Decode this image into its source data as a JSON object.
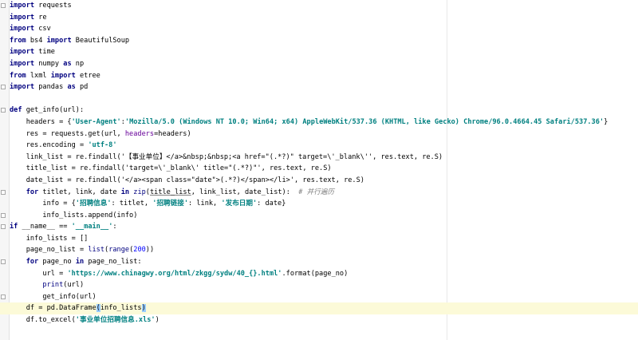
{
  "editor": {
    "lines": [
      {
        "fold": true,
        "tokens": [
          [
            "kw",
            "import"
          ],
          [
            "txt",
            " requests"
          ]
        ]
      },
      {
        "tokens": [
          [
            "kw",
            "import"
          ],
          [
            "txt",
            " re"
          ]
        ]
      },
      {
        "tokens": [
          [
            "kw",
            "import"
          ],
          [
            "txt",
            " csv"
          ]
        ]
      },
      {
        "tokens": [
          [
            "kw",
            "from"
          ],
          [
            "txt",
            " bs4 "
          ],
          [
            "kw",
            "import"
          ],
          [
            "txt",
            " BeautifulSoup"
          ]
        ]
      },
      {
        "tokens": [
          [
            "kw",
            "import"
          ],
          [
            "txt",
            " time"
          ]
        ]
      },
      {
        "tokens": [
          [
            "kw",
            "import"
          ],
          [
            "txt",
            " numpy "
          ],
          [
            "kw",
            "as"
          ],
          [
            "txt",
            " np"
          ]
        ]
      },
      {
        "tokens": [
          [
            "kw",
            "from"
          ],
          [
            "txt",
            " lxml "
          ],
          [
            "kw",
            "import"
          ],
          [
            "txt",
            " etree"
          ]
        ]
      },
      {
        "fold": true,
        "tokens": [
          [
            "kw",
            "import"
          ],
          [
            "txt",
            " pandas "
          ],
          [
            "kw",
            "as"
          ],
          [
            "txt",
            " pd"
          ]
        ]
      },
      {
        "tokens": []
      },
      {
        "fold": true,
        "tokens": [
          [
            "kw",
            "def"
          ],
          [
            "txt",
            " get_info(url):"
          ]
        ]
      },
      {
        "tokens": [
          [
            "txt",
            "    headers = {"
          ],
          [
            "str",
            "'User-Agent'"
          ],
          [
            "txt",
            ":"
          ],
          [
            "str",
            "'Mozilla/5.0 (Windows NT 10.0; Win64; x64) AppleWebKit/537.36 (KHTML, like Gecko) Chrome/96.0.4664.45 Safari/537.36'"
          ],
          [
            "txt",
            "}"
          ]
        ]
      },
      {
        "tokens": [
          [
            "txt",
            "    res = requests.get(url, "
          ],
          [
            "kwarg",
            "headers"
          ],
          [
            "txt",
            "=headers)"
          ]
        ]
      },
      {
        "tokens": [
          [
            "txt",
            "    res.encoding = "
          ],
          [
            "str",
            "'utf-8'"
          ]
        ]
      },
      {
        "tokens": [
          [
            "txt",
            "    link_list = re.findall('【事业单位】</a>&nbsp;&nbsp;<a href=\"(.*?)\" target=\\'_blank\\'', res.text, re.S)"
          ]
        ]
      },
      {
        "tokens": [
          [
            "txt",
            "    title_list = re.findall('target=\\'_blank\\' title=\"(.*?)\"', res.text, re.S)"
          ]
        ]
      },
      {
        "tokens": [
          [
            "txt",
            "    date_list = re.findall('</a><span class=\"date\">(.*?)</span></li>', res.text, re.S)"
          ]
        ]
      },
      {
        "fold": true,
        "tokens": [
          [
            "txt",
            "    "
          ],
          [
            "kw",
            "for"
          ],
          [
            "txt",
            " titlet, link, date "
          ],
          [
            "kw",
            "in"
          ],
          [
            "txt",
            " "
          ],
          [
            "builtin",
            "zip"
          ],
          [
            "txt",
            "("
          ],
          [
            "under",
            "title_list"
          ],
          [
            "txt",
            ", link_list, date_list):  "
          ],
          [
            "cmt",
            "# 并行遍历"
          ]
        ]
      },
      {
        "tokens": [
          [
            "txt",
            "        info = {"
          ],
          [
            "str",
            "'招聘信息'"
          ],
          [
            "txt",
            ": titlet, "
          ],
          [
            "str",
            "'招聘链接'"
          ],
          [
            "txt",
            ": link, "
          ],
          [
            "str",
            "'发布日期'"
          ],
          [
            "txt",
            ": date}"
          ]
        ]
      },
      {
        "fold": true,
        "tokens": [
          [
            "txt",
            "        info_lists.append(info)"
          ]
        ]
      },
      {
        "fold": true,
        "tokens": [
          [
            "kw",
            "if"
          ],
          [
            "txt",
            " __name__ == "
          ],
          [
            "str",
            "'__main__'"
          ],
          [
            "txt",
            ":"
          ]
        ]
      },
      {
        "tokens": [
          [
            "txt",
            "    info_lists = []"
          ]
        ]
      },
      {
        "tokens": [
          [
            "txt",
            "    page_no_list = "
          ],
          [
            "builtin",
            "list"
          ],
          [
            "txt",
            "("
          ],
          [
            "builtin",
            "range"
          ],
          [
            "txt",
            "("
          ],
          [
            "num",
            "200"
          ],
          [
            "txt",
            "))"
          ]
        ]
      },
      {
        "fold": true,
        "tokens": [
          [
            "txt",
            "    "
          ],
          [
            "kw",
            "for"
          ],
          [
            "txt",
            " page_no "
          ],
          [
            "kw",
            "in"
          ],
          [
            "txt",
            " page_no_list:"
          ]
        ]
      },
      {
        "tokens": [
          [
            "txt",
            "        url = "
          ],
          [
            "str",
            "'https://www.chinagwy.org/html/zkgg/sydw/40_{}.html'"
          ],
          [
            "txt",
            ".format(page_no)"
          ]
        ]
      },
      {
        "tokens": [
          [
            "txt",
            "        "
          ],
          [
            "builtin",
            "print"
          ],
          [
            "txt",
            "(url)"
          ]
        ]
      },
      {
        "fold": true,
        "tokens": [
          [
            "txt",
            "        get_info(url)"
          ]
        ]
      },
      {
        "current": true,
        "tokens": [
          [
            "txt",
            "    df = pd.DataFrame"
          ],
          [
            "match",
            "("
          ],
          [
            "txt",
            "info_lists"
          ],
          [
            "match",
            ")"
          ]
        ]
      },
      {
        "tokens": [
          [
            "txt",
            "    df.to_excel("
          ],
          [
            "str",
            "'事业单位招聘信息.xls'"
          ],
          [
            "txt",
            ")"
          ]
        ]
      }
    ]
  }
}
